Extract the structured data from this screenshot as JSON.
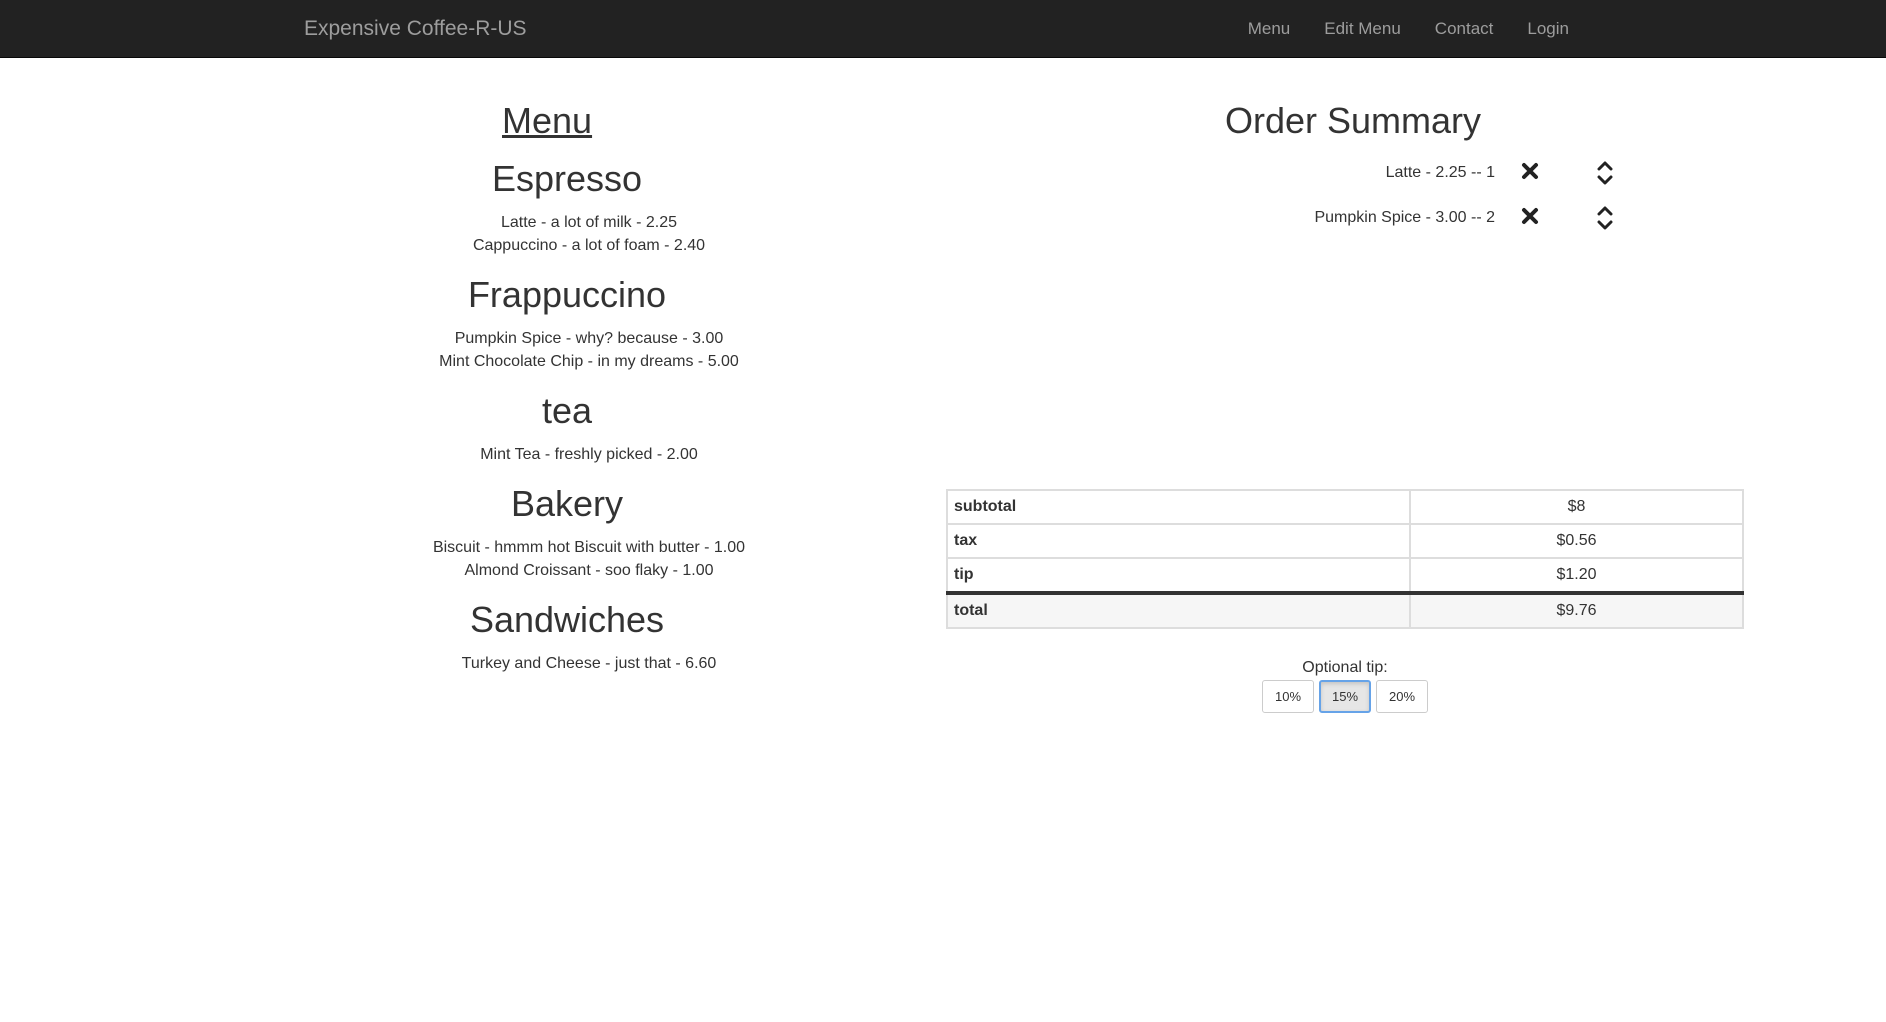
{
  "navbar": {
    "brand": "Expensive Coffee-R-US",
    "links": [
      {
        "label": "Menu"
      },
      {
        "label": "Edit Menu"
      },
      {
        "label": "Contact"
      },
      {
        "label": "Login"
      }
    ]
  },
  "menu": {
    "title": "Menu",
    "categories": [
      {
        "name": "Espresso",
        "items": [
          "Latte - a lot of milk - 2.25",
          "Cappuccino - a lot of foam - 2.40"
        ]
      },
      {
        "name": "Frappuccino",
        "items": [
          "Pumpkin Spice - why? because - 3.00",
          "Mint Chocolate Chip - in my dreams - 5.00"
        ]
      },
      {
        "name": "tea",
        "items": [
          "Mint Tea - freshly picked - 2.00"
        ]
      },
      {
        "name": "Bakery",
        "items": [
          "Biscuit - hmmm hot Biscuit with butter - 1.00",
          "Almond Croissant - soo flaky - 1.00"
        ]
      },
      {
        "name": "Sandwiches",
        "items": [
          "Turkey and Cheese - just that - 6.60"
        ]
      }
    ]
  },
  "order": {
    "title": "Order Summary",
    "items": [
      {
        "text": "Latte - 2.25 -- 1",
        "remove_icon": "close-icon",
        "up_icon": "chevron-up-icon",
        "down_icon": "chevron-down-icon"
      },
      {
        "text": "Pumpkin Spice - 3.00 -- 2",
        "remove_icon": "close-icon",
        "up_icon": "chevron-up-icon",
        "down_icon": "chevron-down-icon"
      }
    ],
    "totals": [
      {
        "label": "subtotal",
        "value": "$8"
      },
      {
        "label": "tax",
        "value": "$0.56"
      },
      {
        "label": "tip",
        "value": "$1.20"
      },
      {
        "label": "total",
        "value": "$9.76"
      }
    ]
  },
  "tip": {
    "label": "Optional tip:",
    "options": [
      "10%",
      "15%",
      "20%"
    ],
    "selected": "15%"
  },
  "colors": {
    "navbar_bg": "#222222",
    "nav_text": "#9d9d9d",
    "active_border": "#66a3e8"
  }
}
